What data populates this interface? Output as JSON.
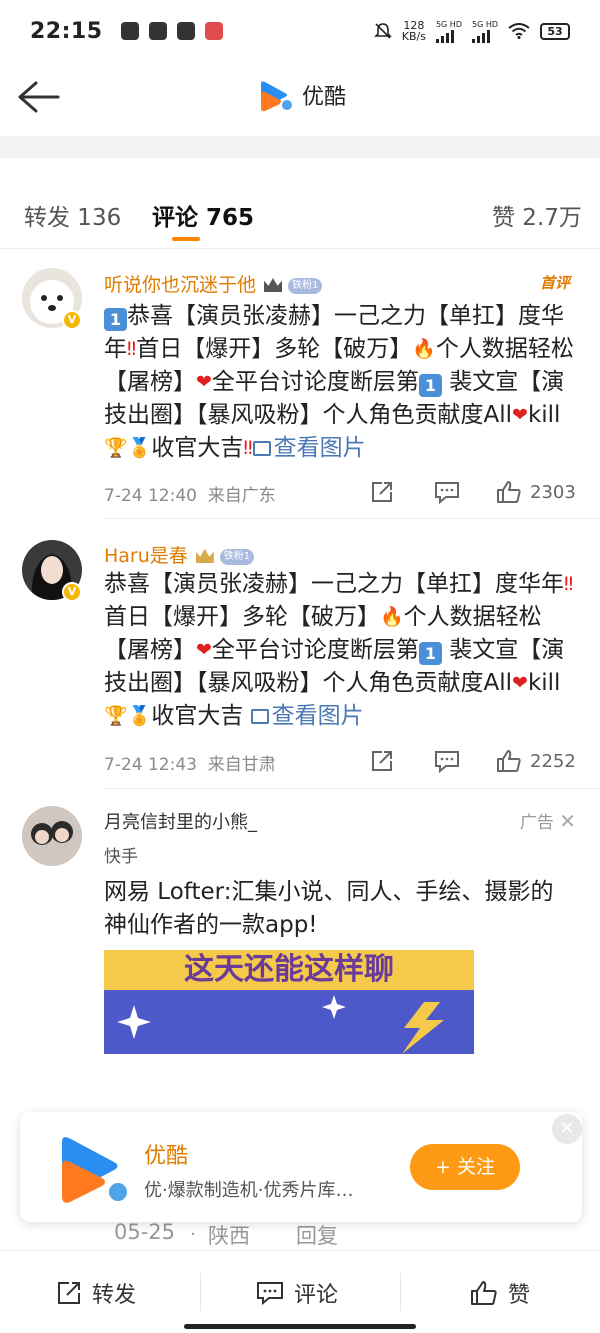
{
  "status_bar": {
    "time": "22:15",
    "net_speed": "128",
    "net_unit": "KB/s",
    "sig1": "5G HD",
    "sig2": "5G HD",
    "battery": "53"
  },
  "nav": {
    "title": "优酷"
  },
  "tabs": [
    {
      "label": "转发 136"
    },
    {
      "label": "评论 765"
    },
    {
      "label": "赞 2.7万"
    }
  ],
  "comments": [
    {
      "user": "听说你也沉迷于他",
      "fan_badge": "铁粉1",
      "first_tag": "首评",
      "text_parts": [
        "恭喜【演员张凌赫】一己之力【单扛】度华年",
        "首日【爆开】多轮【破万】",
        "个人数据轻松【屠榜】",
        "全平台讨论度断层第",
        " 裴文宣【演技出圈】【暴风吸粉】个人角色贡献度All",
        "kill",
        "收官大吉",
        "查看图片"
      ],
      "time": "7-24 12:40",
      "location": "来自广东",
      "likes": "2303"
    },
    {
      "user": "Haru是春",
      "fan_badge": "铁粉1",
      "text_parts": [
        "恭喜【演员张凌赫】一己之力【单扛】度华年",
        "首日【爆开】多轮【破万】",
        "个人数据轻松【屠榜】",
        "全平台讨论度断层第",
        " 裴文宣【演技出圈】【暴风吸粉】个人角色贡献度All",
        "kill",
        "收官大吉 ",
        "查看图片"
      ],
      "time": "7-24 12:43",
      "location": "来自甘肃",
      "likes": "2252"
    }
  ],
  "ad": {
    "name": "月亮信封里的小熊_",
    "tag": "广告",
    "source": "快手",
    "text": "网易 Lofter:汇集小说、同人、手绘、摄影的神仙作者的一款app!",
    "banner_text": "这天还能这样聊"
  },
  "follow_card": {
    "name": "优酷",
    "desc": "优·爆款制造机·优秀片库…",
    "follow_label": "+ 关注"
  },
  "behind_reply": {
    "date": "05-25",
    "location": "陕西",
    "reply": "回复"
  },
  "bottom_bar": {
    "repost": "转发",
    "comment": "评论",
    "like": "赞"
  },
  "colors": {
    "accent": "#ff8200",
    "username": "#e07c00",
    "link": "#4a79b3"
  }
}
